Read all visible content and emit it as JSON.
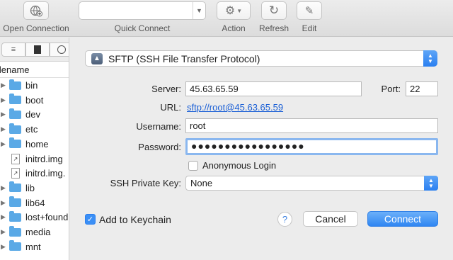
{
  "toolbar": {
    "open_connection": "Open Connection",
    "quick_connect": "Quick Connect",
    "action": "Action",
    "refresh": "Refresh",
    "edit": "Edit"
  },
  "browser": {
    "column_header": "ilename",
    "files": [
      {
        "name": "bin",
        "type": "folder"
      },
      {
        "name": "boot",
        "type": "folder"
      },
      {
        "name": "dev",
        "type": "folder"
      },
      {
        "name": "etc",
        "type": "folder"
      },
      {
        "name": "home",
        "type": "folder"
      },
      {
        "name": "initrd.img",
        "type": "file"
      },
      {
        "name": "initrd.img.",
        "type": "file"
      },
      {
        "name": "lib",
        "type": "folder"
      },
      {
        "name": "lib64",
        "type": "folder"
      },
      {
        "name": "lost+found",
        "type": "folder"
      },
      {
        "name": "media",
        "type": "folder"
      },
      {
        "name": "mnt",
        "type": "folder"
      }
    ]
  },
  "connection": {
    "protocol": "SFTP (SSH File Transfer Protocol)",
    "server_label": "Server:",
    "server_value": "45.63.65.59",
    "port_label": "Port:",
    "port_value": "22",
    "url_label": "URL:",
    "url_value": "sftp://root@45.63.65.59",
    "username_label": "Username:",
    "username_value": "root",
    "password_label": "Password:",
    "password_value": "●●●●●●●●●●●●●●●●●",
    "anonymous_label": "Anonymous Login",
    "anonymous_checked": false,
    "ssh_key_label": "SSH Private Key:",
    "ssh_key_value": "None",
    "keychain_label": "Add to Keychain",
    "keychain_checked": true,
    "help_label": "?",
    "cancel_label": "Cancel",
    "connect_label": "Connect"
  },
  "colors": {
    "accent": "#2f86f2",
    "folder": "#5aa9e6",
    "link": "#1a5fd6"
  }
}
